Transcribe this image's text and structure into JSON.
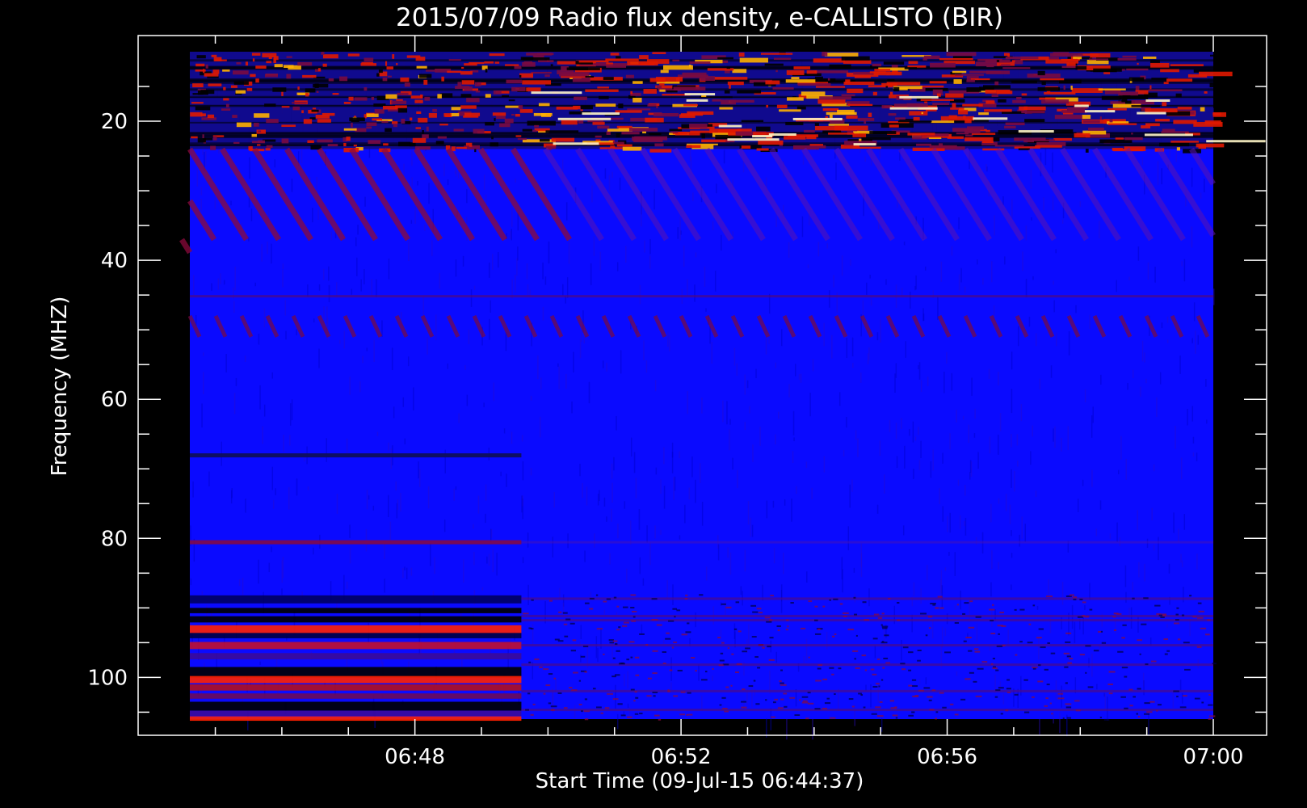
{
  "chart_data": {
    "type": "heatmap",
    "title": "2015/07/09  Radio flux density, e-CALLISTO (BIR)",
    "xlabel": "Start Time (09-Jul-15 06:44:37)",
    "ylabel": "Frequency (MHZ)",
    "x_start_time": "06:44:37",
    "x_ticks": [
      "06:48",
      "06:52",
      "06:56",
      "07:00"
    ],
    "x_tick_minutes": [
      48,
      52,
      56,
      60
    ],
    "x_minor_minutes": [
      45,
      46,
      47,
      49,
      50,
      51,
      53,
      54,
      55,
      57,
      58,
      59
    ],
    "x_range_minutes": [
      44.617,
      60.0
    ],
    "y_ticks": [
      "20",
      "40",
      "60",
      "80",
      "100"
    ],
    "y_tick_values": [
      20,
      40,
      60,
      80,
      100
    ],
    "y_minor_values": [
      15,
      25,
      30,
      35,
      45,
      50,
      55,
      65,
      70,
      75,
      85,
      90,
      95,
      105
    ],
    "y_range": [
      10,
      106
    ],
    "y_inverted": true,
    "colormap": [
      "#000000",
      "#0000ff",
      "#ff0000",
      "#ffff00",
      "#ffffff"
    ],
    "instrument_change_minute": 49.6,
    "features": [
      {
        "kind": "rfi-band-top",
        "freq_range": [
          10,
          24
        ],
        "level": "high"
      },
      {
        "kind": "drifting-stripes",
        "freq_range": [
          24,
          52
        ],
        "level": "medium"
      },
      {
        "kind": "narrow-dark-line",
        "freq": 68,
        "minute_range": [
          44.617,
          49.6
        ]
      },
      {
        "kind": "narrow-red-line",
        "freq": 80.5,
        "minute_range": [
          44.617,
          49.6
        ]
      },
      {
        "kind": "fm-band",
        "freq_range": [
          88,
          106
        ],
        "level": "high"
      }
    ]
  },
  "colors": {
    "background": "#000000",
    "axis": "#ffffff",
    "low_flux": "#0a0aff",
    "medium_flux": "#8b0a3c",
    "high_flux": "#ff2000"
  }
}
